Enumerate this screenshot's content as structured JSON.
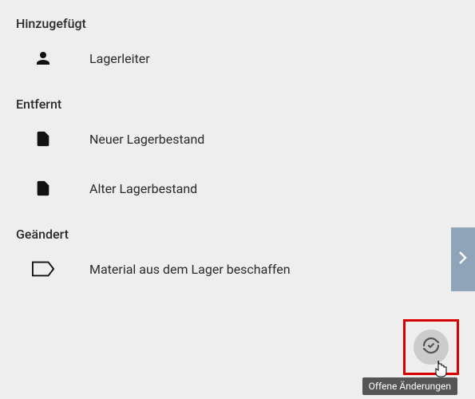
{
  "sections": {
    "added": {
      "title": "Hinzugefügt",
      "items": [
        {
          "label": "Lagerleiter"
        }
      ]
    },
    "removed": {
      "title": "Entfernt",
      "items": [
        {
          "label": "Neuer Lagerbestand"
        },
        {
          "label": "Alter Lagerbestand"
        }
      ]
    },
    "changed": {
      "title": "Geändert",
      "items": [
        {
          "label": "Material aus dem Lager beschaffen"
        }
      ]
    }
  },
  "tooltip": "Offene Änderungen"
}
